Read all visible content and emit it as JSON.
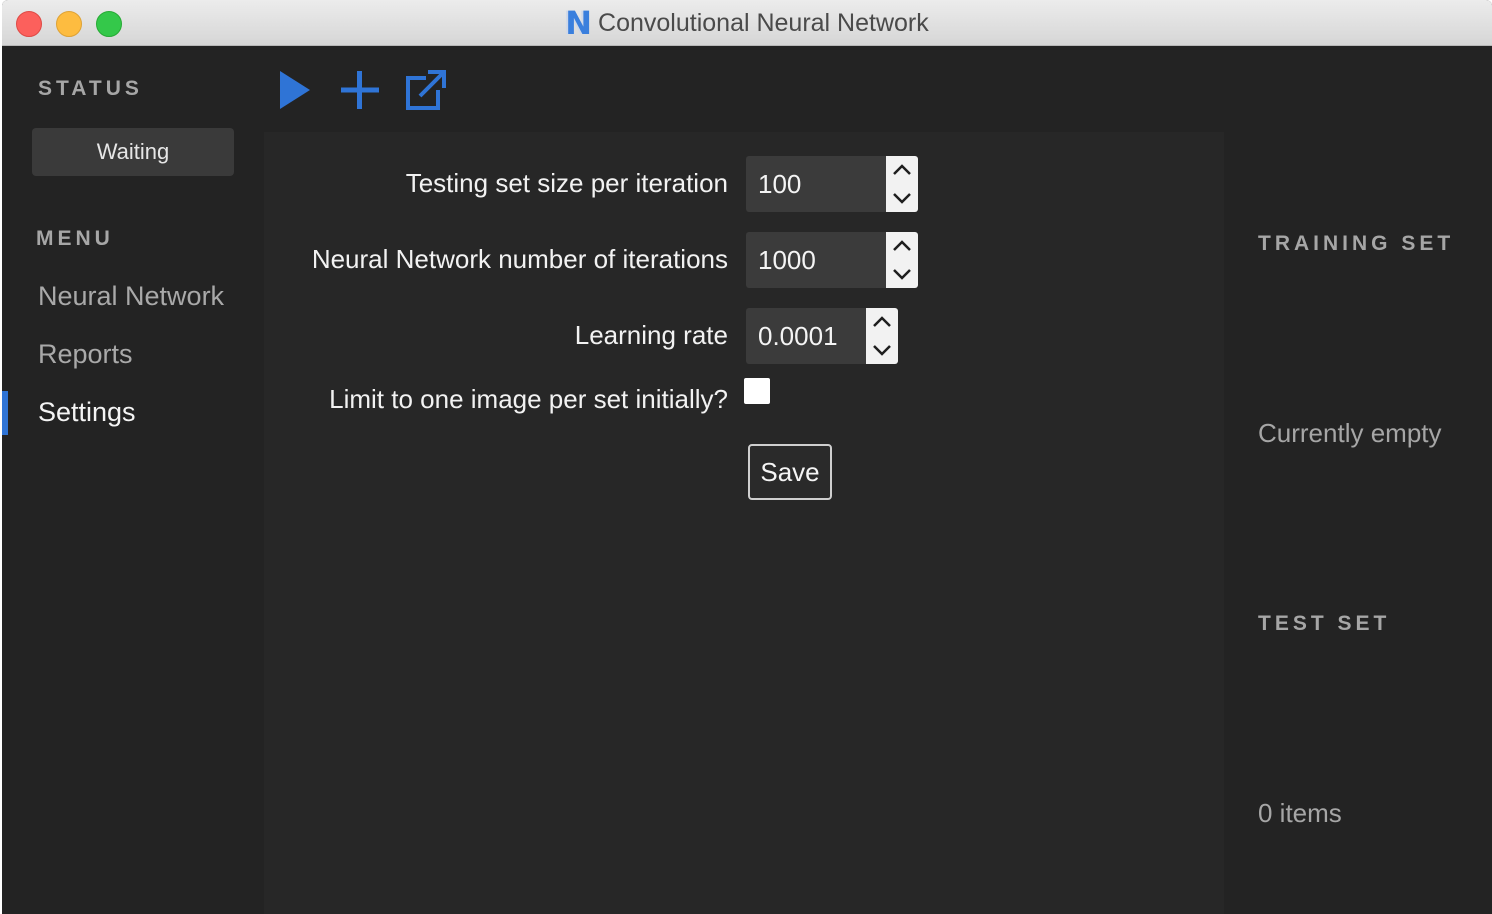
{
  "window": {
    "title": "Convolutional Neural Network",
    "logo_letter": "N"
  },
  "sidebar": {
    "status_heading": "STATUS",
    "status_value": "Waiting",
    "menu_heading": "MENU",
    "items": [
      {
        "label": "Neural Network",
        "active": false
      },
      {
        "label": "Reports",
        "active": false
      },
      {
        "label": "Settings",
        "active": true
      }
    ]
  },
  "toolbar": {
    "icons": [
      "play-icon",
      "plus-icon",
      "external-link-icon"
    ],
    "accent_color": "#2f74d6"
  },
  "settings": {
    "testing_set_size_label": "Testing set size per iteration",
    "testing_set_size_value": "100",
    "iterations_label": "Neural Network number of iterations",
    "iterations_value": "1000",
    "learning_rate_label": "Learning rate",
    "learning_rate_value": "0.0001",
    "limit_one_image_label": "Limit to one image per set initially?",
    "limit_one_image_checked": false,
    "save_label": "Save"
  },
  "right_panel": {
    "training_heading": "TRAINING SET",
    "training_value": "Currently empty",
    "test_heading": "TEST SET",
    "test_value": "0 items"
  }
}
